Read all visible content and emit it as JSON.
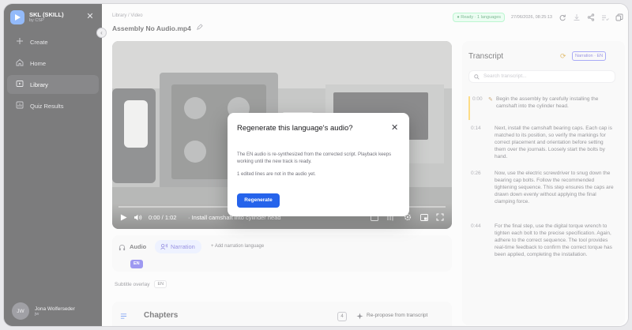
{
  "brand": {
    "name": "SKL (SKILL)",
    "sub": "by CSP"
  },
  "sidebar": {
    "items": [
      {
        "label": "Create",
        "icon": "plus-icon"
      },
      {
        "label": "Home",
        "icon": "home-icon"
      },
      {
        "label": "Library",
        "icon": "library-icon",
        "active": true
      },
      {
        "label": "Quiz Results",
        "icon": "chart-icon"
      }
    ]
  },
  "user": {
    "initials": "JW",
    "name": "Jona Wolferseder",
    "role": "jw"
  },
  "header": {
    "breadcrumb": "Library / Video",
    "title": "Assembly No Audio.mp4",
    "status": "● Ready · 1 languages",
    "timestamp": "27/06/2026, 08:25:13"
  },
  "video": {
    "time": "0:00 / 1:02",
    "caption": "· Install camshaft into cylinder head"
  },
  "audio": {
    "label": "Audio",
    "narration_label": "Narration",
    "add_language": "+ Add narration language",
    "lang_chip": "EN"
  },
  "subtitle_overlay": {
    "label": "Subtitle overlay",
    "lang": "EN"
  },
  "chapters": {
    "title": "Chapters",
    "count": "4",
    "repropose": "Re-propose from transcript"
  },
  "transcript": {
    "title": "Transcript",
    "narration_badge": "Narration · EN",
    "search_placeholder": "Search transcript...",
    "segments": [
      {
        "time": "0:00",
        "text": "Begin the assembly by carefully installing the camshaft into the cylinder head."
      },
      {
        "time": "0:14",
        "text": "Next, install the camshaft bearing caps. Each cap is matched to its position, so verify the markings for correct placement and orientation before setting them over the journals. Loosely start the bolts by hand."
      },
      {
        "time": "0:26",
        "text": "Now, use the electric screwdriver to snug down the bearing cap bolts. Follow the recommended tightening sequence. This step ensures the caps are drawn down evenly without applying the final clamping force."
      },
      {
        "time": "0:44",
        "text": "For the final step, use the digital torque wrench to tighten each bolt to the precise specification. Again, adhere to the correct sequence. The tool provides real-time feedback to confirm the correct torque has been applied, completing the installation."
      }
    ]
  },
  "modal": {
    "title": "Regenerate this language's audio?",
    "body": "The EN audio is re-synthesized from the corrected script. Playback keeps working until the new track is ready.",
    "note": "1 edited lines are not in the audio yet.",
    "button": "Regenerate"
  }
}
